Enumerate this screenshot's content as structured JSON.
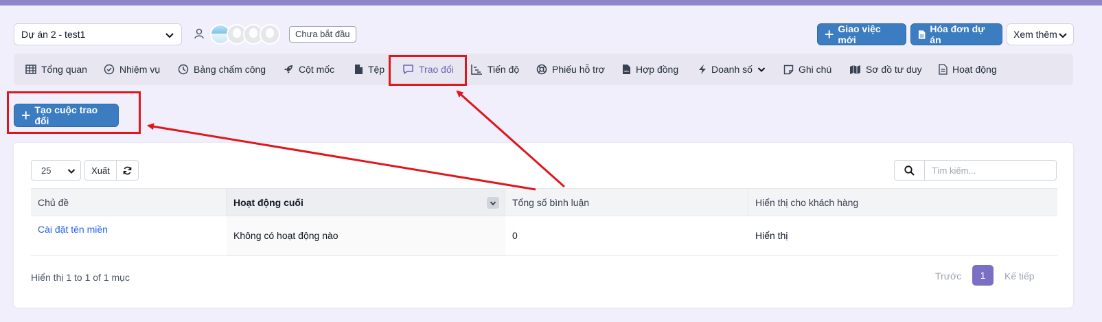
{
  "header": {
    "project_select": "Dự án 2 - test1",
    "status_badge": "Chưa bắt đầu",
    "new_task_label": "Giao việc mới",
    "invoice_label": "Hóa đơn dự án",
    "more_label": "Xem thêm"
  },
  "tabs": [
    {
      "label": "Tổng quan",
      "icon": "table-icon"
    },
    {
      "label": "Nhiệm vụ",
      "icon": "check-circle-icon"
    },
    {
      "label": "Bảng chấm công",
      "icon": "clock-icon"
    },
    {
      "label": "Cột mốc",
      "icon": "rocket-icon"
    },
    {
      "label": "Tệp",
      "icon": "file-icon"
    },
    {
      "label": "Trao đổi",
      "icon": "chat-icon",
      "active": true
    },
    {
      "label": "Tiến độ",
      "icon": "chart-icon"
    },
    {
      "label": "Phiếu hỗ trợ",
      "icon": "lifebuoy-icon"
    },
    {
      "label": "Hợp đồng",
      "icon": "contract-icon"
    },
    {
      "label": "Doanh số",
      "icon": "bolt-icon"
    },
    {
      "label": "Ghi chú",
      "icon": "note-icon"
    },
    {
      "label": "Sơ đồ tư duy",
      "icon": "map-icon"
    },
    {
      "label": "Hoạt động",
      "icon": "document-icon"
    }
  ],
  "create_button": "Tạo cuộc trao đổi",
  "table_tools": {
    "page_size": "25",
    "export_label": "Xuất",
    "search_placeholder": "Tìm kiếm..."
  },
  "table": {
    "columns": [
      "Chủ đề",
      "Hoạt động cuối",
      "Tổng số bình luận",
      "Hiển thị cho khách hàng"
    ],
    "rows": [
      {
        "topic": "Cài đặt tên miền",
        "last_activity": "Không có hoạt động nào",
        "comments": "0",
        "visible": "Hiển thị"
      }
    ]
  },
  "footer": {
    "info": "Hiển thị 1 to 1 of 1 mục",
    "prev": "Trước",
    "page": "1",
    "next": "Kế tiếp"
  },
  "colors": {
    "accent": "#3b7dc0",
    "active_tab": "#6b64b8",
    "annotation": "#e0161b"
  }
}
